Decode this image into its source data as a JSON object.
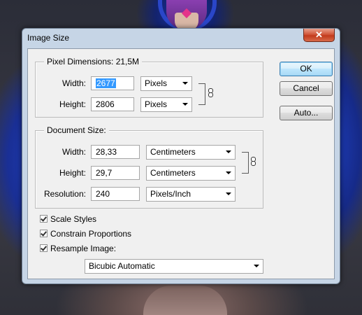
{
  "dialog": {
    "title": "Image Size",
    "close_glyph": "✕"
  },
  "pixel_dimensions": {
    "legend": "Pixel Dimensions:  21,5M",
    "width_label": "Width:",
    "width_value": "2677",
    "width_unit": "Pixels",
    "height_label": "Height:",
    "height_value": "2806",
    "height_unit": "Pixels"
  },
  "document_size": {
    "legend": "Document Size:",
    "width_label": "Width:",
    "width_value": "28,33",
    "width_unit": "Centimeters",
    "height_label": "Height:",
    "height_value": "29,7",
    "height_unit": "Centimeters",
    "resolution_label": "Resolution:",
    "resolution_value": "240",
    "resolution_unit": "Pixels/Inch"
  },
  "buttons": {
    "ok": "OK",
    "cancel": "Cancel",
    "auto": "Auto..."
  },
  "options": {
    "scale_styles": "Scale Styles",
    "constrain_proportions": "Constrain Proportions",
    "resample_image": "Resample Image:",
    "resample_method": "Bicubic Automatic"
  },
  "checked": {
    "scale_styles": true,
    "constrain_proportions": true,
    "resample_image": true
  },
  "icons": {
    "link": "chain-link-icon",
    "close": "close-icon",
    "dropdown": "chevron-down-icon"
  }
}
